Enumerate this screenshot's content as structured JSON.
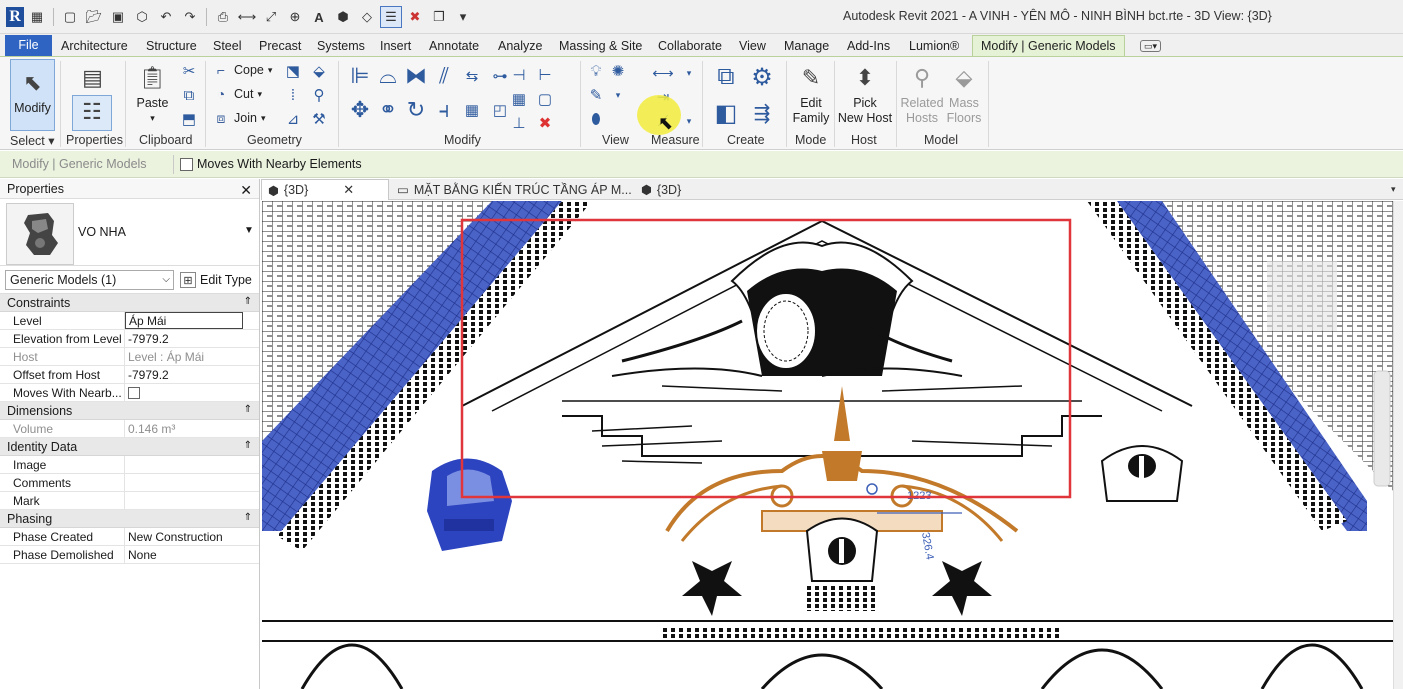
{
  "titlebar": {
    "app_title": "Autodesk Revit 2021 - A VINH - YÊN MÔ - NINH BÌNH bct.rte - 3D View: {3D}",
    "qat_icons": [
      "revit-logo-icon",
      "home-icon",
      "new-icon",
      "open-icon",
      "save-icon",
      "sync-icon",
      "undo-icon",
      "redo-icon",
      "print-icon",
      "measure-icon",
      "dimension-icon",
      "tag-icon",
      "text-icon",
      "3d-view-icon",
      "section-icon",
      "thin-lines-icon",
      "close-hidden-icon",
      "switch-windows-icon",
      "customize-icon"
    ]
  },
  "menu": {
    "tabs": [
      "File",
      "Architecture",
      "Structure",
      "Steel",
      "Precast",
      "Systems",
      "Insert",
      "Annotate",
      "Analyze",
      "Massing & Site",
      "Collaborate",
      "View",
      "Manage",
      "Add-Ins",
      "Lumion®",
      "Modify | Generic Models"
    ],
    "active": "Modify | Generic Models"
  },
  "ribbon": {
    "select": {
      "modify_label": "Modify",
      "panel_label": "Select"
    },
    "properties": {
      "panel_label": "Properties"
    },
    "clipboard": {
      "paste_label": "Paste",
      "panel_label": "Clipboard"
    },
    "geometry": {
      "cope_label": "Cope",
      "cut_label": "Cut",
      "join_label": "Join",
      "panel_label": "Geometry"
    },
    "modify": {
      "panel_label": "Modify"
    },
    "view": {
      "panel_label": "View"
    },
    "measure": {
      "panel_label": "Measure"
    },
    "create": {
      "panel_label": "Create"
    },
    "mode": {
      "edit_family_label": "Edit\nFamily",
      "panel_label": "Mode"
    },
    "host": {
      "pick_new_host_label": "Pick\nNew Host",
      "panel_label": "Host"
    },
    "model": {
      "related_hosts_label": "Related\nHosts",
      "mass_floors_label": "Mass\nFloors",
      "panel_label": "Model"
    }
  },
  "contextbar": {
    "label": "Modify | Generic Models",
    "moves_label": "Moves With Nearby Elements",
    "moves_checked": false
  },
  "properties": {
    "title": "Properties",
    "type_name": "VO NHA",
    "instance_selector": "Generic Models (1)",
    "edit_type_label": "Edit Type",
    "sections": [
      {
        "name": "Constraints",
        "rows": [
          {
            "k": "Level",
            "v": "Áp Mái",
            "editing": true
          },
          {
            "k": "Elevation from Level",
            "v": "-7979.2"
          },
          {
            "k": "Host",
            "v": "Level : Áp Mái",
            "readonly": true
          },
          {
            "k": "Offset from Host",
            "v": "-7979.2"
          },
          {
            "k": "Moves With Nearb...",
            "v": "",
            "checkbox": true
          }
        ]
      },
      {
        "name": "Dimensions",
        "rows": [
          {
            "k": "Volume",
            "v": "0.146 m³",
            "readonly": true
          }
        ]
      },
      {
        "name": "Identity Data",
        "rows": [
          {
            "k": "Image",
            "v": ""
          },
          {
            "k": "Comments",
            "v": ""
          },
          {
            "k": "Mark",
            "v": ""
          }
        ]
      },
      {
        "name": "Phasing",
        "rows": [
          {
            "k": "Phase Created",
            "v": "New Construction"
          },
          {
            "k": "Phase Demolished",
            "v": "None"
          }
        ]
      }
    ]
  },
  "views": {
    "tabs": [
      {
        "label": "{3D}",
        "active": true
      },
      {
        "label": "MẶT BẰNG KIẾN TRÚC TẦNG ÁP M...",
        "active": false
      },
      {
        "label": "{3D}",
        "active": false
      }
    ]
  },
  "canvas": {
    "dimension_text_1": "1223",
    "dimension_text_2": "326.4",
    "colors": {
      "roof": "#3a55b5",
      "selected": "#2d44c0",
      "ornament": "#c27a2a",
      "redbox": "#e0363b"
    }
  }
}
